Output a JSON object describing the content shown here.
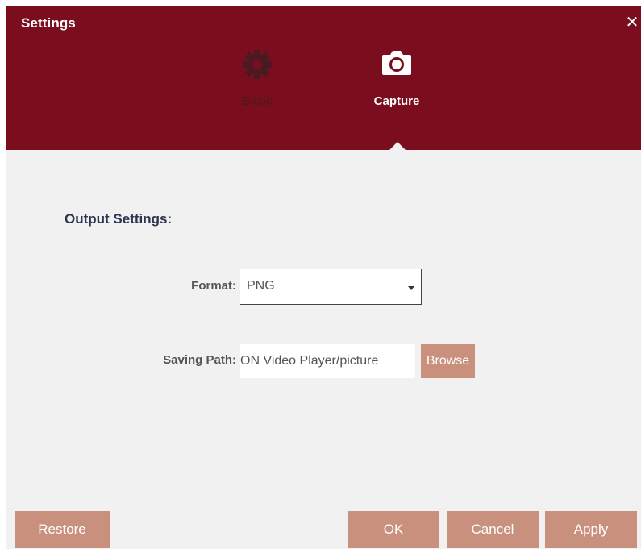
{
  "window": {
    "title": "Settings",
    "close_symbol": "✕"
  },
  "tabs": [
    {
      "label": "Basic",
      "icon": "gear-icon",
      "active": false
    },
    {
      "label": "Capture",
      "icon": "camera-icon",
      "active": true
    }
  ],
  "output_settings": {
    "heading": "Output Settings:",
    "format": {
      "label": "Format:",
      "value": "PNG"
    },
    "saving_path": {
      "label": "Saving Path:",
      "value": "ON Video Player/picture",
      "browse_label": "Browse"
    }
  },
  "footer": {
    "restore_label": "Restore",
    "ok_label": "OK",
    "cancel_label": "Cancel",
    "apply_label": "Apply"
  },
  "colors": {
    "header": "#7a0e1e",
    "body": "#f1f1f1",
    "button": "#c9907d",
    "inactive_tab": "#4a1a22",
    "heading": "#2e3550"
  }
}
